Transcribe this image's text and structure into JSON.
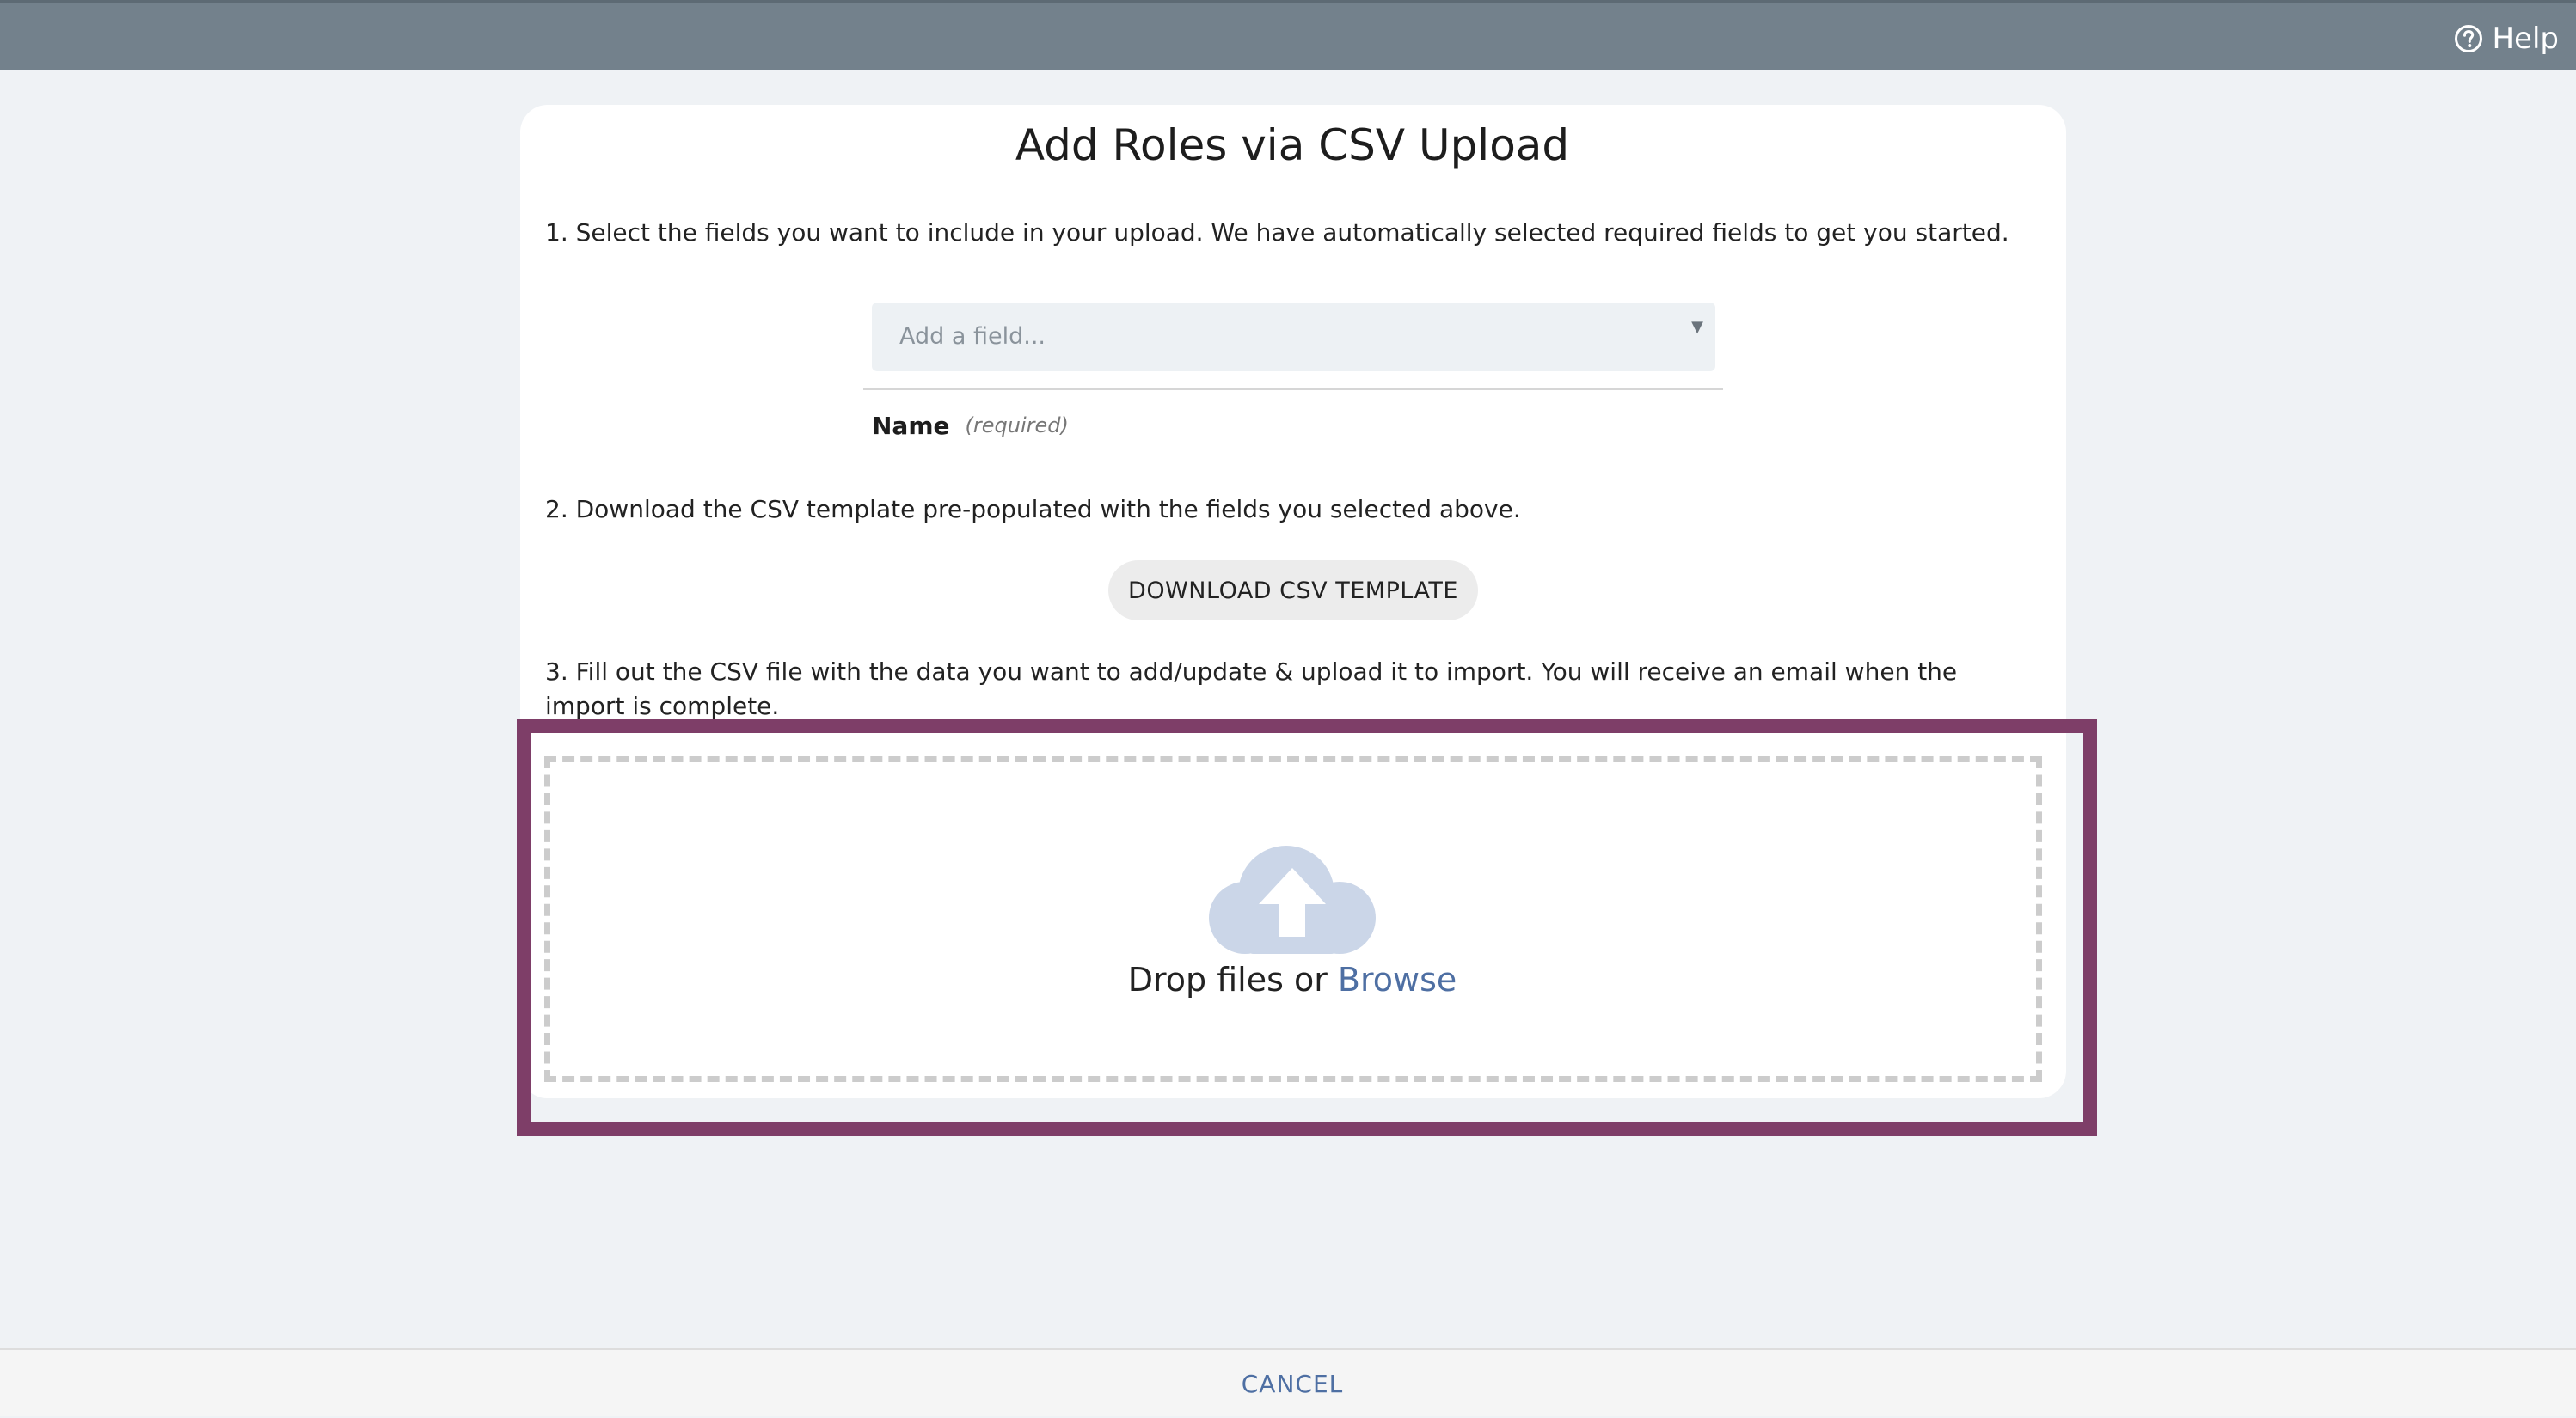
{
  "header": {
    "help_label": "Help"
  },
  "page": {
    "title": "Add Roles via CSV Upload"
  },
  "steps": {
    "step1": "1. Select the fields you want to include in your upload. We have automatically selected required fields to get you started.",
    "step2": "2. Download the CSV template pre-populated with the fields you selected above.",
    "step3": "3. Fill out the CSV file with the data you want to add/update & upload it to import. You will receive an email when the import is complete."
  },
  "field_select": {
    "placeholder": "Add a field...",
    "icon": "chevron-down-icon"
  },
  "selected_fields": [
    {
      "name": "Name",
      "note": "(required)"
    }
  ],
  "download": {
    "label": "DOWNLOAD CSV TEMPLATE"
  },
  "dropzone": {
    "icon": "cloud-upload-icon",
    "text": "Drop files or",
    "browse_label": "Browse"
  },
  "footer": {
    "cancel_label": "CANCEL"
  },
  "colors": {
    "topbar": "#73818c",
    "highlight_border": "#7e3e68",
    "link": "#4e6fa3",
    "cloud": "#cbd6e8",
    "background": "#eff2f5"
  }
}
